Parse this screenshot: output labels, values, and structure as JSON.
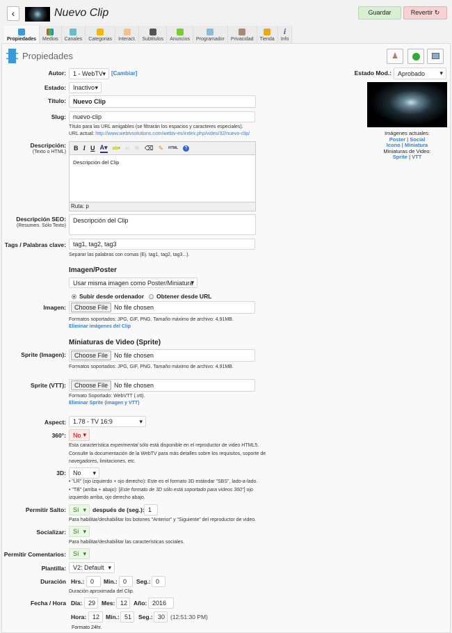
{
  "header": {
    "title": "Nuevo Clip",
    "save": "Guardar",
    "revert": "Revertir ↻",
    "back_icon": "chevron-left-icon"
  },
  "tabs": [
    "Propiedades",
    "Medios",
    "Canales",
    "Categorias",
    "Interact.",
    "Subtitulos",
    "Anuncios",
    "Programador",
    "Privacidad",
    "Tienda",
    "Info"
  ],
  "section_title": "Propiedades",
  "form": {
    "autor_label": "Autor:",
    "autor_value": "1 - WebTV",
    "cambiar": "[Cambiar]",
    "estado_mod_label": "Estado Mod.:",
    "estado_mod_value": "Aprobado",
    "estado_label": "Estado:",
    "estado_value": "Inactivo",
    "titulo_label": "Título:",
    "titulo_value": "Nuevo Clip",
    "slug_label": "Slug:",
    "slug_value": "nuevo-clip",
    "slug_help": "Título para las URL amigables (se filtrarán los espacios y caracteres especiales).",
    "url_label": "URL actual:",
    "url_value": "http://www.webtvsolutions.com/webtv-es/index.php/video/32/nuevo-clip/",
    "desc_label": "Descripción:",
    "desc_sub": "(Texto o HTML)",
    "desc_value": "Descripción del Clip",
    "desc_path": "Ruta: p",
    "seo_label": "Descripción SEO:",
    "seo_sub": "(Resumen. Sólo Texto)",
    "seo_value": "Descripción del Clip",
    "tags_label": "Tags / Palabras clave:",
    "tags_value": "tag1, tag2, tag3",
    "tags_help": "Separar las palabras con comas (Ej. tag1, tag2, tag3...).",
    "poster_heading": "Imagen/Poster",
    "poster_select": "Usar misma imagen como Poster/Miniatura",
    "radio_upload": "Subir desde ordenador",
    "radio_url": "Obtener desde URL",
    "imagen_label": "Imagen:",
    "choose_file": "Choose File",
    "no_file": "No file chosen",
    "img_formats": "Formatos soportados: JPG, GIF, PNG. Tamaño máximo de archivo: 4.91MB.",
    "img_delete": "Eliminar imágenes del Clip",
    "sprite_heading": "Miniaturas de Video (Sprite)",
    "sprite_img_label": "Sprite (Imagen):",
    "sprite_vtt_label": "Sprite (VTT):",
    "vtt_format": "Formato Soportado: WebVTT (.vtt).",
    "sprite_delete": "Eliminar Sprite (imagen y VTT)",
    "aspect_label": "Aspect:",
    "aspect_value": "1.78 - TV 16:9",
    "v360_label": "360°:",
    "v360_value": "No",
    "v360_help1a": "Esta característica ",
    "v360_help1b": "experimental",
    "v360_help1c": " sólo está disponible en el reproductor de video HTML5.",
    "v360_help2": "Consulte la documentación de la WebTV para más detalles sobre los requisitos, soporte de",
    "v360_help3": "navegadores, limitaciones, etc.",
    "d3_label": "3D:",
    "d3_value": "No",
    "d3_help1": "• \"LR\" (ojo izquierdo + ojo derecho): Este es el formato 3D estándar \"SBS\", lado-a-lado.",
    "d3_help2a": "• \"TB\" (arriba + abajo): [",
    "d3_help2b": "Este formato de 3D sólo está soportado para videos 360°",
    "d3_help2c": "] ojo",
    "d3_help3": "izquierdo arriba, ojo derecho abajo.",
    "salto_label": "Permitir Salto:",
    "salto_value": "Sí",
    "despues_label": "después de (seg.):",
    "despues_value": "1",
    "salto_help": "Para habilitar/deshabilitar los botones \"Anterior\" y \"Siguiente\" del reproductor de video.",
    "social_label": "Socializar:",
    "social_value": "Sí",
    "social_help": "Para habilitar/deshabilitar las características sociales.",
    "coment_label": "Permitir Comentarios:",
    "coment_value": "Sí",
    "plantilla_label": "Plantilla:",
    "plantilla_value": "V2: Default",
    "duracion_label": "Duración",
    "hrs_label": "Hrs.:",
    "hrs": "0",
    "min_label": "Min.:",
    "min": "0",
    "seg_label": "Seg.:",
    "seg": "0",
    "duracion_help": "Duración aproximada del Clip.",
    "fecha_label": "Fecha / Hora",
    "dia_label": "Día:",
    "dia": "29",
    "mes_label": "Mes:",
    "mes": "12",
    "ano_label": "Año:",
    "ano": "2016",
    "hora_label": "Hora:",
    "hora": "12",
    "min2_label": "Min.:",
    "min2": "51",
    "seg2_label": "Seg.:",
    "seg2": "30",
    "time12": "(12:51:30 PM)",
    "formato": "Formato 24hr."
  },
  "images": {
    "caption1": "Imágenes actuales:",
    "poster": "Poster",
    "social": "Social",
    "icono": "Icono",
    "miniatura": "Miniatura",
    "caption2": "Miniaturas de Video:",
    "sprite": "Sprite",
    "vtt": "VTT",
    "sep": "|"
  }
}
